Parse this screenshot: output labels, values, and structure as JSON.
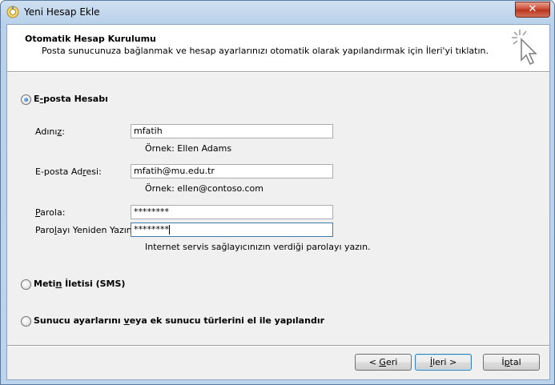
{
  "window": {
    "title": "Yeni Hesap Ekle",
    "close_glyph": "✕"
  },
  "header": {
    "title": "Otomatik Hesap Kurulumu",
    "description": "Posta sunucunuza bağlanmak ve hesap ayarlarınızı otomatik olarak yapılandırmak için İleri'yi tıklatın."
  },
  "options": {
    "email": {
      "pre": "E",
      "ul": "-",
      "post": "posta Hesabı",
      "selected": true
    },
    "sms": {
      "pre": "Meti",
      "ul": "n",
      "post": " İletisi (SMS)",
      "selected": false
    },
    "manual": {
      "pre": "Sunucu ayarlarını ",
      "ul": "v",
      "post": "eya ek sunucu türlerini el ile yapılandır",
      "selected": false
    }
  },
  "form": {
    "name": {
      "label_pre": "Adını",
      "label_ul": "z",
      "label_post": ":",
      "value": "mfatih",
      "hint": "Örnek: Ellen Adams"
    },
    "email": {
      "label_pre": "E-posta Ad",
      "label_ul": "r",
      "label_post": "esi:",
      "value": "mfatih@mu.edu.tr",
      "hint": "Örnek: ellen@contoso.com"
    },
    "password": {
      "label_pre": "",
      "label_ul": "P",
      "label_post": "arola:",
      "value": "********"
    },
    "password_retype": {
      "label_pre": "Paro",
      "label_ul": "l",
      "label_post": "ayı Yeniden Yazın:",
      "value": "********",
      "hint": "Internet servis sağlayıcınızın verdiği parolayı yazın."
    }
  },
  "buttons": {
    "back": {
      "pre": "< ",
      "ul": "G",
      "post": "eri"
    },
    "next": {
      "pre": "",
      "ul": "İ",
      "post": "leri >"
    },
    "cancel": {
      "pre": "İ",
      "ul": "p",
      "post": "tal"
    }
  },
  "colors": {
    "titlebar": "#b9d1ea",
    "close_button": "#c7452f",
    "dialog_bg": "#f0f0f0",
    "radio_dot": "#1e5fb4"
  }
}
